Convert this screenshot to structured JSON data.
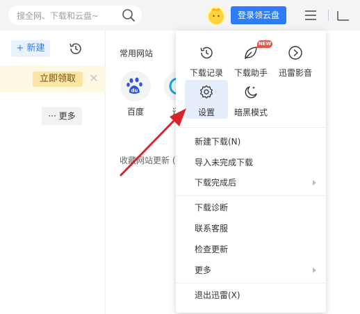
{
  "topbar": {
    "search_placeholder": "搜全网、下载和云盘~",
    "login_label": "登录领云盘"
  },
  "sidebar": {
    "new_label": "+ 新建",
    "promo_label": "立即领取",
    "close_glyph": "✕",
    "more_label": "··· 更多"
  },
  "main": {
    "section_title": "常用网站",
    "sites": [
      {
        "label": "百度"
      },
      {
        "label": "迅"
      }
    ],
    "updates_label": "收藏网站更新 ("
  },
  "menu": {
    "grid": [
      {
        "label": "下载记录",
        "icon": "clock-icon"
      },
      {
        "label": "下载助手",
        "icon": "leaf-icon",
        "badge": "NEW"
      },
      {
        "label": "迅雷影音",
        "icon": "play-circle-icon"
      },
      {
        "label": "设置",
        "icon": "gear-icon"
      },
      {
        "label": "暗黑模式",
        "icon": "moon-icon"
      }
    ],
    "items": [
      {
        "label": "新建下载(N)"
      },
      {
        "label": "导入未完成下载"
      },
      {
        "label": "下载完成后"
      },
      {
        "label": "下载诊断"
      },
      {
        "label": "联系客服"
      },
      {
        "label": "检查更新"
      },
      {
        "label": "更多"
      },
      {
        "label": "退出迅雷(X)"
      }
    ]
  },
  "colors": {
    "accent": "#2e7cf6",
    "annotation_arrow": "#d9232a",
    "badge": "#f24f43"
  }
}
